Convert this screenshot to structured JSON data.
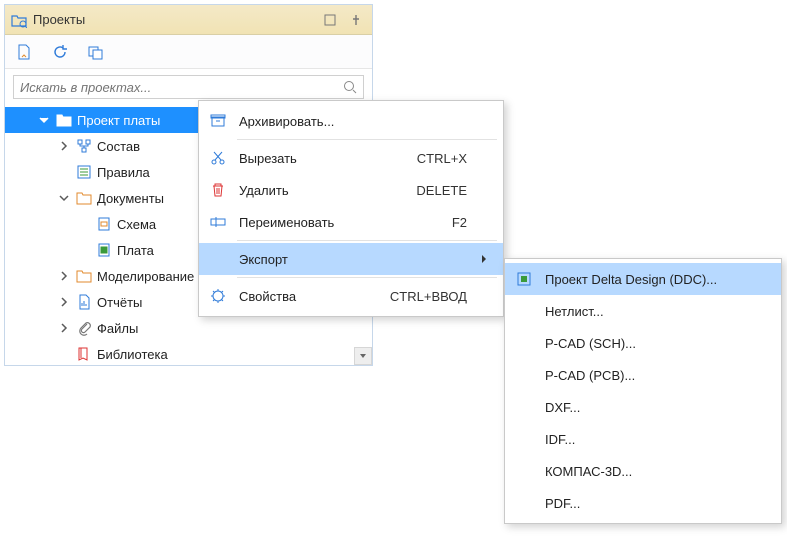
{
  "panel": {
    "title": "Проекты"
  },
  "search": {
    "placeholder": "Искать в проектах..."
  },
  "tree": [
    {
      "label": "Проект платы",
      "indent": 0,
      "arrow": "down",
      "icon": "folder-board",
      "selected": true
    },
    {
      "label": "Состав",
      "indent": 1,
      "arrow": "right",
      "icon": "tree-icon",
      "selected": false
    },
    {
      "label": "Правила",
      "indent": 1,
      "arrow": "",
      "icon": "rules-icon",
      "selected": false
    },
    {
      "label": "Документы",
      "indent": 1,
      "arrow": "down",
      "icon": "folder-icon",
      "selected": false
    },
    {
      "label": "Схема",
      "indent": 2,
      "arrow": "",
      "icon": "schem-icon",
      "selected": false
    },
    {
      "label": "Плата",
      "indent": 2,
      "arrow": "",
      "icon": "board-icon",
      "selected": false
    },
    {
      "label": "Моделирование",
      "indent": 1,
      "arrow": "right",
      "icon": "folder-icon",
      "selected": false
    },
    {
      "label": "Отчёты",
      "indent": 1,
      "arrow": "right",
      "icon": "report-icon",
      "selected": false
    },
    {
      "label": "Файлы",
      "indent": 1,
      "arrow": "right",
      "icon": "clip-icon",
      "selected": false
    },
    {
      "label": "Библиотека",
      "indent": 1,
      "arrow": "",
      "icon": "library-icon",
      "selected": false
    }
  ],
  "context_menu": [
    {
      "label": "Архивировать...",
      "shortcut": "",
      "icon": "archive-icon",
      "submenu": false,
      "hover": false
    },
    {
      "sep": true
    },
    {
      "label": "Вырезать",
      "shortcut": "CTRL+X",
      "icon": "cut-icon",
      "submenu": false,
      "hover": false
    },
    {
      "label": "Удалить",
      "shortcut": "DELETE",
      "icon": "trash-icon",
      "submenu": false,
      "hover": false
    },
    {
      "label": "Переименовать",
      "shortcut": "F2",
      "icon": "rename-icon",
      "submenu": false,
      "hover": false
    },
    {
      "sep": true
    },
    {
      "label": "Экспорт",
      "shortcut": "",
      "icon": "",
      "submenu": true,
      "hover": true
    },
    {
      "sep": true
    },
    {
      "label": "Свойства",
      "shortcut": "CTRL+ВВОД",
      "icon": "props-icon",
      "submenu": false,
      "hover": false
    }
  ],
  "export_submenu": [
    {
      "label": "Проект Delta Design (DDC)...",
      "icon": "ddc-icon",
      "hover": true
    },
    {
      "label": "Нетлист...",
      "icon": "",
      "hover": false
    },
    {
      "label": "P-CAD (SCH)...",
      "icon": "",
      "hover": false
    },
    {
      "label": "P-CAD (PCB)...",
      "icon": "",
      "hover": false
    },
    {
      "label": "DXF...",
      "icon": "",
      "hover": false
    },
    {
      "label": "IDF...",
      "icon": "",
      "hover": false
    },
    {
      "label": "КОМПАС-3D...",
      "icon": "",
      "hover": false
    },
    {
      "label": "PDF...",
      "icon": "",
      "hover": false
    }
  ]
}
